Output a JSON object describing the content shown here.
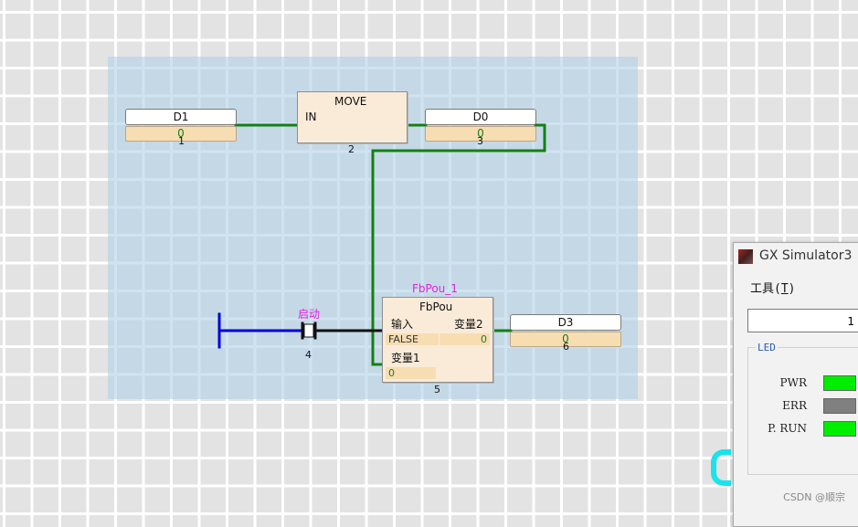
{
  "diagram": {
    "var_d1": {
      "name": "D1",
      "value": "0",
      "index": "1"
    },
    "move_block": {
      "title": "MOVE",
      "input": "IN",
      "index": "2"
    },
    "var_d0": {
      "name": "D0",
      "value": "0",
      "index": "3"
    },
    "contact": {
      "label": "启动",
      "index": "4"
    },
    "fb_block": {
      "instance": "FbPou_1",
      "title": "FbPou",
      "in1_label": "输入",
      "in1_value": "FALSE",
      "in2_label": "变量1",
      "in2_value": "0",
      "out_label": "变量2",
      "out_value": "0",
      "index": "5"
    },
    "var_d3": {
      "name": "D3",
      "value": "0",
      "index": "6"
    }
  },
  "simulator": {
    "title": "GX Simulator3",
    "menu_prefix": "工具(",
    "menu_key": "T",
    "menu_suffix": ")",
    "field_value": "1",
    "led_legend": "LED",
    "leds": [
      {
        "label": "PWR",
        "color": "#00ee00"
      },
      {
        "label": "ERR",
        "color": "#808080"
      },
      {
        "label": "P. RUN",
        "color": "#00ee00"
      }
    ]
  },
  "watermark": "CSDN @顺宗",
  "colors": {
    "wire_active": "#138013",
    "wire_blue": "#0000dd",
    "instance_name": "#e020e0"
  }
}
